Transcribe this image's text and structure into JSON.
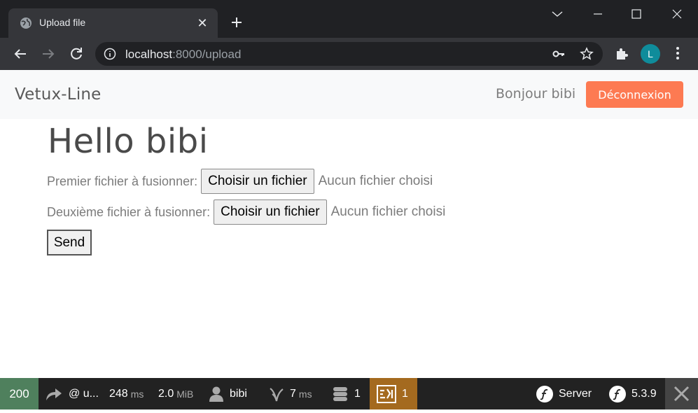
{
  "browser": {
    "tab_title": "Upload file",
    "url_host": "localhost",
    "url_rest": ":8000/upload",
    "profile_initial": "L"
  },
  "navbar": {
    "brand": "Vetux-Line",
    "greeting": "Bonjour bibi",
    "logout_label": "Déconnexion",
    "logout_color": "#fd7a52"
  },
  "main": {
    "title": "Hello bibi",
    "file1_label": "Premier fichier à fusionner:",
    "file2_label": "Deuxième fichier à fusionner:",
    "choose_label": "Choisir un fichier",
    "no_file_text": "Aucun fichier choisi",
    "send_label": "Send"
  },
  "profiler": {
    "status_code": "200",
    "route": "@ u...",
    "time_value": "248",
    "time_unit": "ms",
    "memory_value": "2.0",
    "memory_unit": "MiB",
    "user": "bibi",
    "twig_value": "7",
    "twig_unit": "ms",
    "db_count": "1",
    "warn_count": "1",
    "server_label": "Server",
    "version": "5.3.9",
    "status_color": "#4f805d",
    "warn_color": "#a46a1f"
  }
}
